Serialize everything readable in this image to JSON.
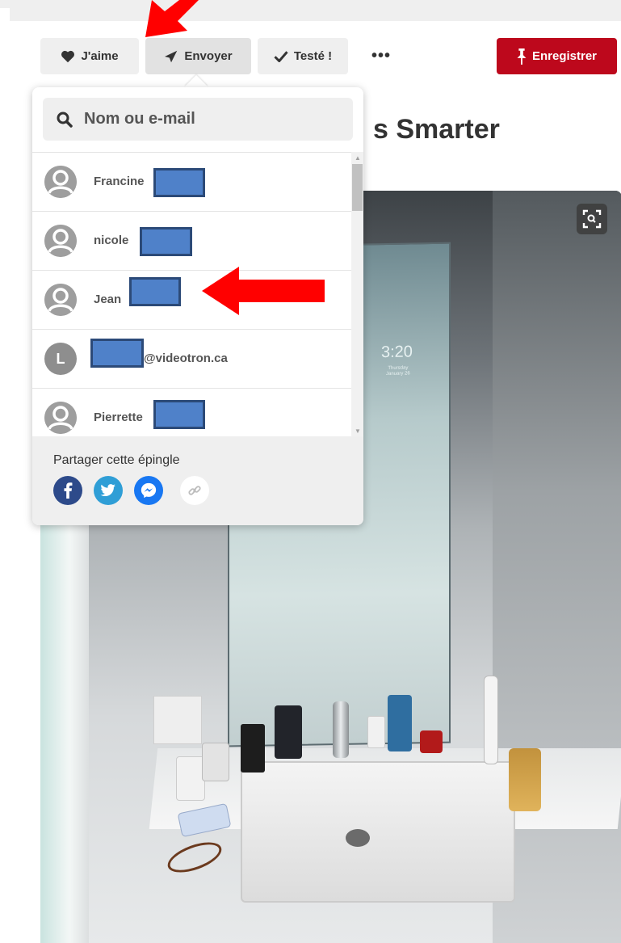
{
  "toolbar": {
    "like_label": "J'aime",
    "send_label": "Envoyer",
    "tried_label": "Testé !",
    "more_label": "•••",
    "save_label": "Enregistrer"
  },
  "pin": {
    "title_fragment": "s Smarter"
  },
  "photo": {
    "clock": "3:20",
    "date": "Thursday\nJanuary 26"
  },
  "send_popover": {
    "search_placeholder": "Nom ou e-mail",
    "contacts": [
      {
        "name": "Francine",
        "avatar": "default-user-icon"
      },
      {
        "name": "nicole",
        "avatar": "default-user-icon"
      },
      {
        "name": "Jean",
        "avatar": "default-user-icon"
      },
      {
        "name": "@videotron.ca",
        "avatar_letter": "L"
      },
      {
        "name": "Pierrette",
        "avatar": "default-user-icon"
      }
    ],
    "share_label": "Partager cette épingle",
    "share_targets": [
      "facebook-icon",
      "twitter-icon",
      "messenger-icon",
      "link-icon"
    ]
  },
  "colors": {
    "save_button": "#bd081c",
    "facebook": "#3b5998",
    "twitter": "#1da1f2",
    "messenger": "#0084ff",
    "annotation_arrow": "#ff0000",
    "redaction": "#4f81c9"
  }
}
